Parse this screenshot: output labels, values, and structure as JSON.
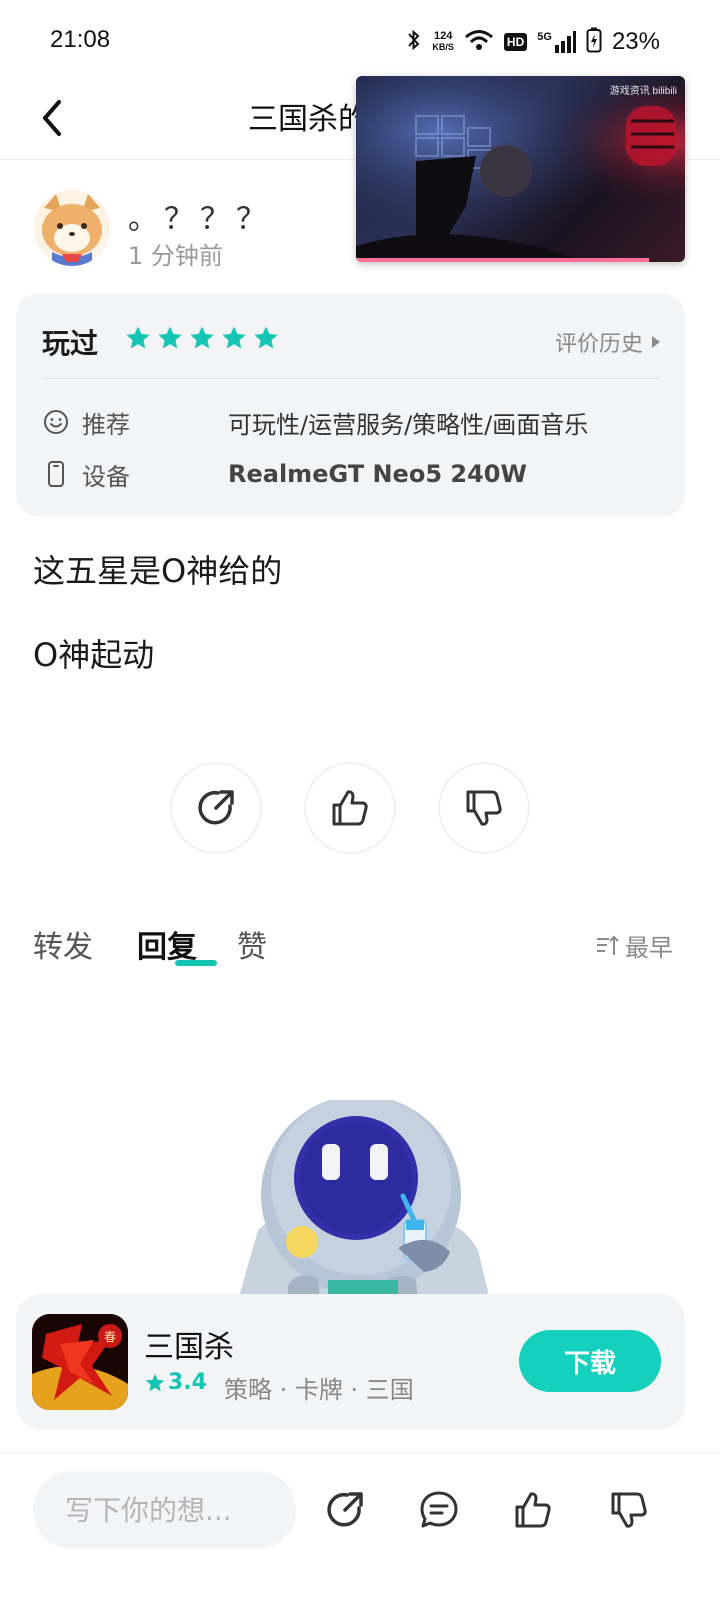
{
  "status_bar": {
    "time": "21:08",
    "net_speed_value": "124",
    "net_speed_unit": "KB/S",
    "hd_badge": "HD",
    "signal_label": "5G",
    "battery": "23%"
  },
  "topbar": {
    "title": "三国杀的"
  },
  "video_pip": {
    "watermark": "游戏资讯 bilibili",
    "progress": 0.89
  },
  "author": {
    "name": "。？？？",
    "time": "1 分钟前"
  },
  "info_card": {
    "played_label": "玩过",
    "stars": 5,
    "history_label": "评价历史",
    "recommend_label": "推荐",
    "recommend_value": "可玩性/运营服务/策略性/画面音乐",
    "device_label": "设备",
    "device_value": "RealmeGT Neo5 240W"
  },
  "review": {
    "line1": "这五星是O神给的",
    "line2": "O神起动"
  },
  "tabs": {
    "items": [
      "转发",
      "回复",
      "赞"
    ],
    "active_index": 1,
    "sort_label": "最早"
  },
  "app": {
    "name": "三国杀",
    "rating": "3.4",
    "tags": "策略 · 卡牌 · 三国",
    "download_label": "下载"
  },
  "bottom_bar": {
    "input_placeholder": "写下你的想..."
  },
  "colors": {
    "accent": "#15c5b3",
    "card_bg": "#f3f4f6",
    "pip_progress": "#ff6f93"
  },
  "icons": {
    "back": "chevron-left-icon",
    "share": "share-icon",
    "like": "thumbs-up-icon",
    "dislike": "thumbs-down-icon",
    "comment": "comment-icon",
    "recommend": "smile-icon",
    "device": "phone-icon",
    "sort": "sort-icon"
  }
}
